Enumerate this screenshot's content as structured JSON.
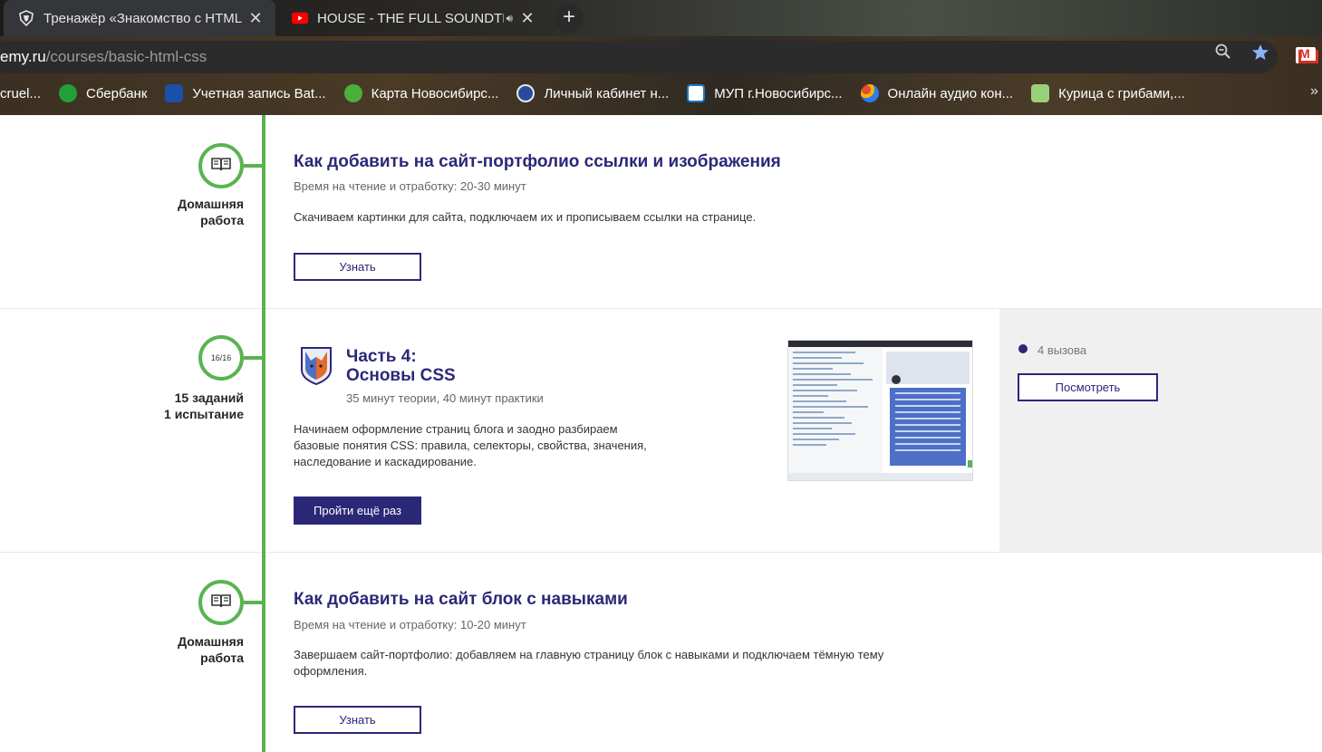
{
  "tabs": [
    {
      "title": "Тренажёр «Знакомство с HTML",
      "icon": "htmlacademy-shield-icon",
      "active": true
    },
    {
      "title": "HOUSE - THE FULL SOUNDTR",
      "icon": "youtube-icon",
      "active": false,
      "audio": "speaker-icon"
    }
  ],
  "omnibox": {
    "host": "emy.ru",
    "path": "/courses/basic-html-css"
  },
  "bookmarks": [
    {
      "label": "cruel...",
      "icon": "bookmark-icon"
    },
    {
      "label": "Сбербанк",
      "icon": "sberbank-icon",
      "color": "#21a038"
    },
    {
      "label": "Учетная запись Bat...",
      "icon": "battlenet-icon",
      "color": "#1b4fa8"
    },
    {
      "label": "Карта Новосибирс...",
      "icon": "map-icon",
      "color": "#4caf3c"
    },
    {
      "label": "Личный кабинет н...",
      "icon": "tax-service-icon",
      "color": "#2b4a9e"
    },
    {
      "label": "МУП г.Новосибирс...",
      "icon": "water-drop-icon",
      "color": "#1c79c8"
    },
    {
      "label": "Онлайн аудио кон...",
      "icon": "audio-converter-icon",
      "color": "#e94b35"
    },
    {
      "label": "Курица с грибами,...",
      "icon": "recipe-icon",
      "color": "#9bd07a"
    }
  ],
  "items": [
    {
      "type": "homework",
      "label_line1": "Домашняя",
      "label_line2": "работа",
      "title": "Как добавить на сайт-портфолио ссылки и изображения",
      "meta": "Время на чтение и отработку: 20-30 минут",
      "description": "Скачиваем картинки для сайта, подключаем их и прописываем ссылки на странице.",
      "button": "Узнать"
    },
    {
      "type": "chapter",
      "counter": "16/16",
      "label_line1": "15 заданий",
      "label_line2": "1 испытание",
      "title_line1": "Часть 4:",
      "title_line2": "Основы CSS",
      "meta": "35 минут теории, 40 минут практики",
      "description": "Начинаем оформление страниц блога и заодно разбираем базовые понятия CSS: правила, селекторы, свойства, значения, наследование и каскадирование.",
      "button": "Пройти ещё раз",
      "challenges": "4 вызова",
      "view_button": "Посмотреть"
    },
    {
      "type": "homework",
      "label_line1": "Домашняя",
      "label_line2": "работа",
      "title": "Как добавить на сайт блок с навыками",
      "meta": "Время на чтение и отработку: 10-20 минут",
      "description": "Завершаем сайт-портфолио: добавляем на главную страницу блок с навыками и подключаем тёмную тему оформления.",
      "button": "Узнать"
    }
  ],
  "colors": {
    "accent": "#2b2878",
    "timeline": "#5bb352"
  }
}
